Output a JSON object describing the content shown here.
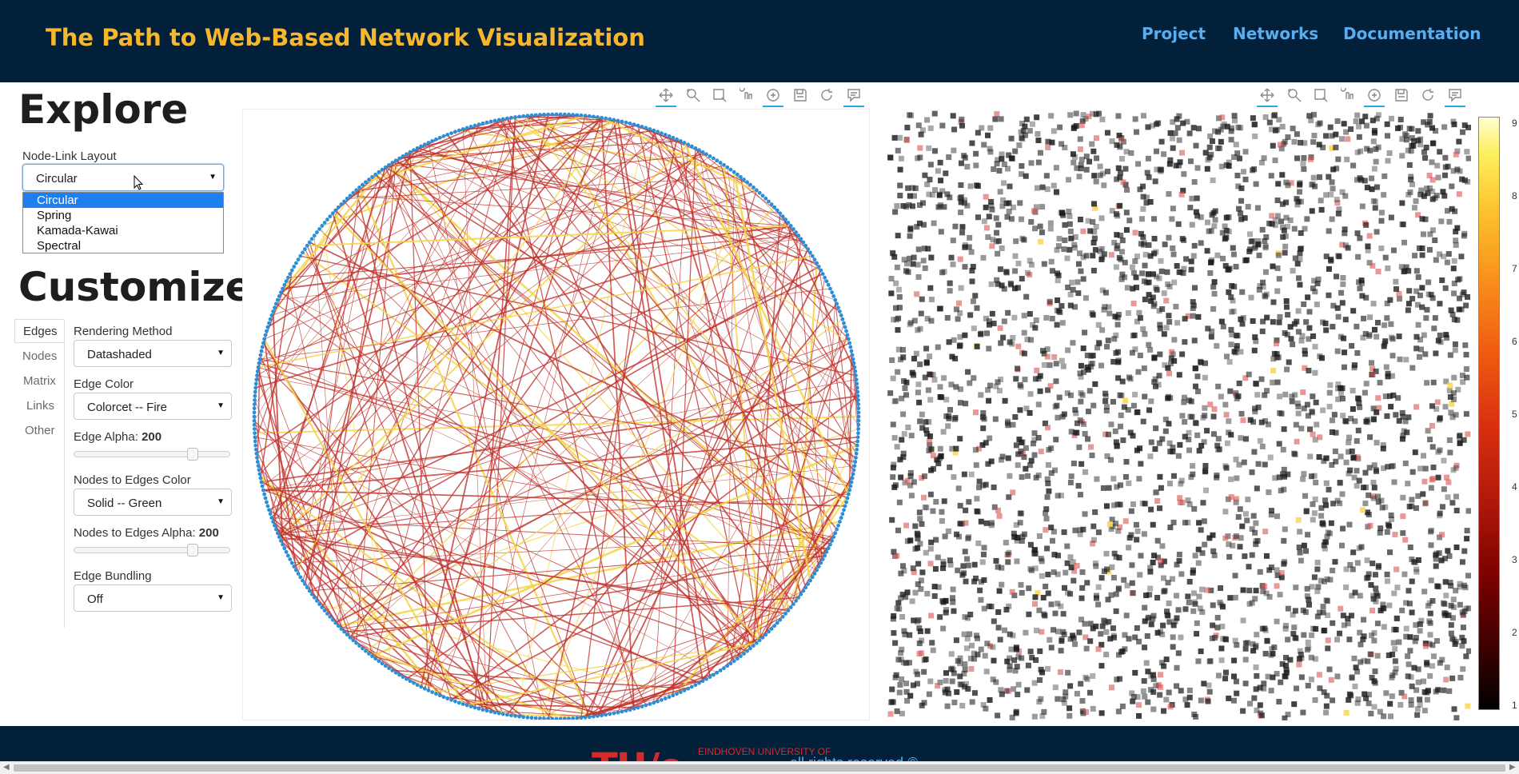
{
  "header": {
    "title": "The Path to Web-Based Network Visualization",
    "nav": [
      "Project",
      "Networks",
      "Documentation"
    ]
  },
  "explore": {
    "heading": "Explore",
    "layout_label": "Node-Link Layout",
    "layout_selected": "Circular",
    "layout_options": [
      "Circular",
      "Spring",
      "Kamada-Kawai",
      "Spectral"
    ]
  },
  "customize": {
    "heading": "Customize",
    "tabs": [
      "Edges",
      "Nodes",
      "Matrix",
      "Links",
      "Other"
    ],
    "active_tab": "Edges",
    "rendering_method": {
      "label": "Rendering Method",
      "value": "Datashaded"
    },
    "edge_color": {
      "label": "Edge Color",
      "value": "Colorcet -- Fire"
    },
    "edge_alpha": {
      "label": "Edge Alpha: ",
      "value": "200",
      "fraction": 0.78
    },
    "nodes_to_edges_color": {
      "label": "Nodes to Edges Color",
      "value": "Solid -- Green"
    },
    "nodes_to_edges_alpha": {
      "label": "Nodes to Edges Alpha: ",
      "value": "200",
      "fraction": 0.78
    },
    "edge_bundling": {
      "label": "Edge Bundling",
      "value": "Off"
    }
  },
  "toolbar_icons": [
    "pan-icon",
    "box-zoom-icon",
    "box-select-icon",
    "tap-icon",
    "wheel-zoom-icon",
    "save-icon",
    "reset-icon",
    "hover-icon"
  ],
  "colorbar": {
    "ticks": [
      "9",
      "8",
      "7",
      "6",
      "5",
      "4",
      "3",
      "2",
      "1"
    ],
    "range": [
      1,
      9
    ]
  },
  "colors": {
    "nav_bg": "#03203a",
    "title": "#f7b72c",
    "nav_link": "#5aaef0",
    "node": "#2b8fd8",
    "edge_red": "#c0302a",
    "edge_yellow": "#f5d547",
    "footer_logo": "#d7292a"
  },
  "footer": {
    "logo": "TU/e",
    "university": "EINDHOVEN UNIVERSITY OF",
    "rights": "all rights reserved ©"
  }
}
